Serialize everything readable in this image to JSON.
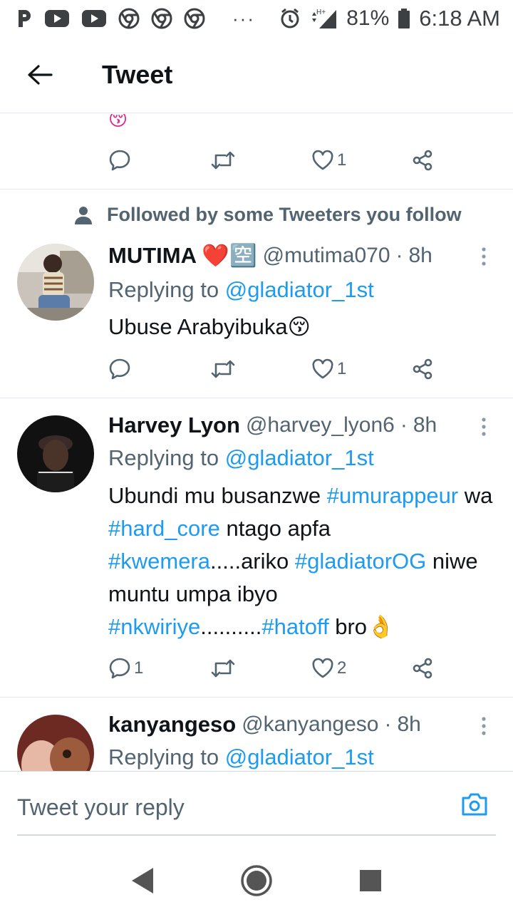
{
  "status_bar": {
    "battery": "81%",
    "time": "6:18 AM",
    "network": "H+"
  },
  "header": {
    "title": "Tweet"
  },
  "partial_tweet": {
    "emoji_tail": "😚",
    "likes": "1"
  },
  "tweets": [
    {
      "social_context": "Followed by some Tweeters you follow",
      "name": "MUTIMA ❤️🈳",
      "handle": "@mutima070",
      "time": "8h",
      "replying_prefix": "Replying to ",
      "replying_to": "@gladiator_1st",
      "text": "Ubuse Arabyibuka😚",
      "replies": "",
      "retweets": "",
      "likes": "1"
    },
    {
      "name": "Harvey Lyon",
      "handle": "@harvey_lyon6",
      "time": "8h",
      "replying_prefix": "Replying to ",
      "replying_to": "@gladiator_1st",
      "text_parts": [
        "Ubundi mu busanzwe ",
        "#umurappeur",
        " wa ",
        "#hard_core",
        " ntago apfa ",
        "#kwemera",
        ".....ariko ",
        "#gladiatorOG",
        " niwe muntu umpa ibyo ",
        "#nkwiriye",
        "..........",
        "#hatoff",
        " bro👌"
      ],
      "replies": "1",
      "retweets": "",
      "likes": "2"
    },
    {
      "name": "kanyangeso",
      "handle": "@kanyangeso",
      "time": "8h",
      "replying_prefix": "Replying to ",
      "replying_to": "@gladiator_1st"
    }
  ],
  "composer": {
    "placeholder": "Tweet your reply"
  },
  "colors": {
    "accent": "#1d9bf0",
    "secondary_text": "#536471",
    "divider": "#e1e8ed",
    "heart": "#e0245e"
  }
}
